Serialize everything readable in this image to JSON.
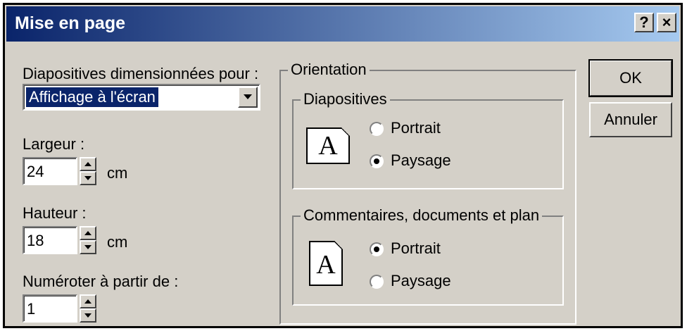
{
  "window": {
    "title": "Mise en page",
    "help_label": "?",
    "close_label": "×"
  },
  "left": {
    "size_label": "Diapositives dimensionnées pour :",
    "size_value": "Affichage à l'écran",
    "width_label": "Largeur :",
    "width_value": "24",
    "width_unit": "cm",
    "height_label": "Hauteur :",
    "height_value": "18",
    "height_unit": "cm",
    "number_label": "Numéroter à partir de :",
    "number_value": "1"
  },
  "orientation": {
    "title": "Orientation",
    "slides": {
      "title": "Diapositives",
      "icon_letter": "A",
      "portrait_label": "Portrait",
      "landscape_label": "Paysage",
      "selected": "landscape"
    },
    "notes": {
      "title": "Commentaires, documents et plan",
      "icon_letter": "A",
      "portrait_label": "Portrait",
      "landscape_label": "Paysage",
      "selected": "portrait"
    }
  },
  "buttons": {
    "ok_label": "OK",
    "cancel_label": "Annuler"
  },
  "colors": {
    "face": "#d4d0c8",
    "titlebar": "#0a246a",
    "selection": "#0a246a"
  }
}
